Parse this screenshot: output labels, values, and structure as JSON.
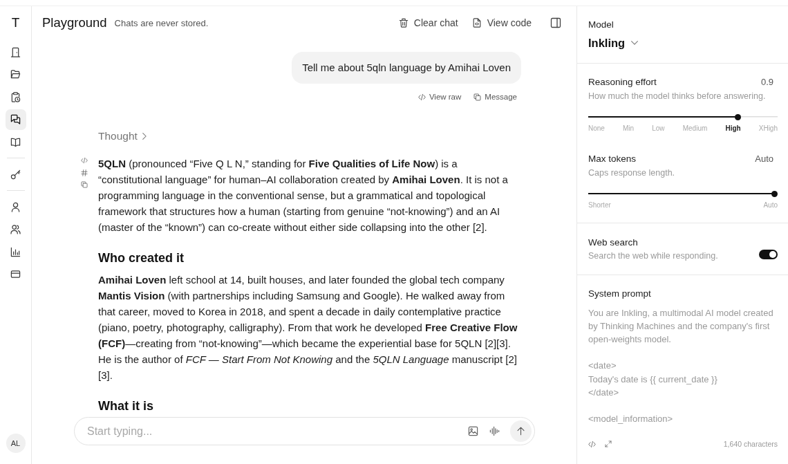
{
  "sidebar": {
    "logo": "T",
    "groups": [
      {
        "items": [
          {
            "selected": false
          },
          {
            "selected": false
          },
          {
            "selected": false
          },
          {
            "selected": true
          },
          {
            "selected": false
          }
        ]
      },
      {
        "items": [
          {
            "selected": false
          }
        ]
      },
      {
        "items": [
          {
            "selected": false
          },
          {
            "selected": false
          },
          {
            "selected": false
          },
          {
            "selected": false
          }
        ]
      }
    ],
    "avatar": "AL"
  },
  "header": {
    "title": "Playground",
    "subtitle": "Chats are never stored.",
    "actions": [
      "Clear chat",
      "View code"
    ]
  },
  "chat": {
    "messages": [
      {
        "kind": "prompt",
        "text": "Tell me about 5qln language by Amihai Loven",
        "actions": [
          "View raw",
          "Message"
        ]
      },
      {
        "kind": "reply",
        "thought": {
          "label": "Thought",
          "expanded": false
        },
        "blocks": [
          {
            "kind": "paragraph",
            "text": "**5QLN** (pronounced “Five Q L N,” standing for **Five Qualities of Life Now**) is a “constitutional language” for human–AI collaboration created by **Amihai Loven**. It is not a programming language in the conventional sense, but a grammatical and topological framework that structures how a human (starting from genuine “not-knowing”) and an AI (master of the “known”) can co-create without either side collapsing into the other [2]."
          },
          {
            "kind": "heading",
            "text": "Who created it"
          },
          {
            "kind": "paragraph",
            "text": "**Amihai Loven** left school at 14, built houses, and later founded the global tech company **Mantis Vision** (with partnerships including Samsung and Google). He walked away from that career, moved to Korea in 2018, and spent a decade in daily contemplative practice (piano, poetry, photography, calligraphy). From that work he developed **Free Creative Flow (FCF)**—creating from “not-knowing”—which became the experiential base for 5QLN [2][3]. He is the author of *FCF — Start From Not Knowing* and the *5QLN Language* manuscript [2] [3]."
          },
          {
            "kind": "heading",
            "text": "What it is"
          }
        ]
      }
    ]
  },
  "composer": {
    "placeholder": "Start typing..."
  },
  "settings": {
    "model": {
      "label": "Model",
      "value": "Inkling"
    },
    "reasoning_effort": {
      "label": "Reasoning effort",
      "reading": "0.9",
      "description": "How much the model thinks before answering.",
      "level": 0.8,
      "stops": [
        {
          "label": "None",
          "selected": false
        },
        {
          "label": "Min",
          "selected": false
        },
        {
          "label": "Low",
          "selected": false
        },
        {
          "label": "Medium",
          "selected": false
        },
        {
          "label": "High",
          "selected": true
        },
        {
          "label": "XHigh",
          "selected": false
        }
      ]
    },
    "max_tokens": {
      "label": "Max tokens",
      "reading": "Auto",
      "description": "Caps response length.",
      "level": 1,
      "stops": [
        {
          "label": "Shorter",
          "selected": false
        },
        {
          "label": "Auto",
          "selected": false
        }
      ]
    },
    "web_search": {
      "label": "Web search",
      "description": "Search the web while responding.",
      "on": true
    },
    "system_prompt": {
      "label": "System prompt",
      "value": "You are Inkling, a multimodal AI model created by Thinking Machines and the company's first open-weights model.\n\n<date>\nToday's date is {{ current_date }}\n</date>\n\n<model_information>",
      "count": "1,640 characters"
    }
  }
}
